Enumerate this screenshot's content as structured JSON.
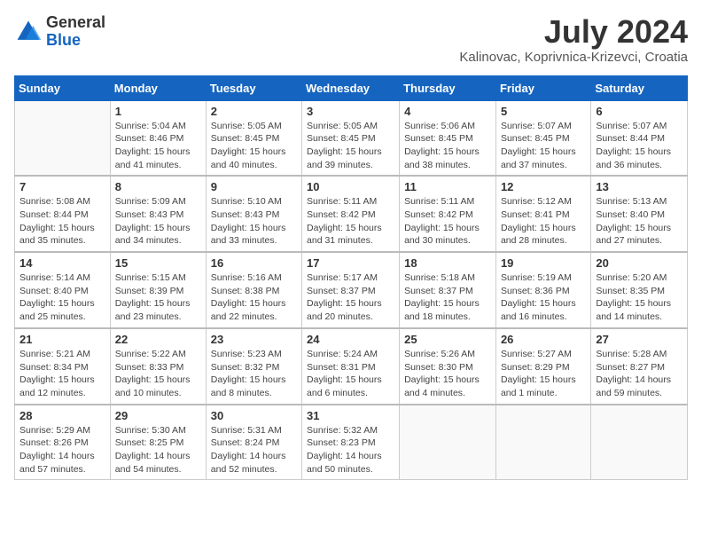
{
  "header": {
    "logo_general": "General",
    "logo_blue": "Blue",
    "month_year": "July 2024",
    "location": "Kalinovac, Koprivnica-Krizevci, Croatia"
  },
  "days_of_week": [
    "Sunday",
    "Monday",
    "Tuesday",
    "Wednesday",
    "Thursday",
    "Friday",
    "Saturday"
  ],
  "weeks": [
    [
      {
        "day": "",
        "info": ""
      },
      {
        "day": "1",
        "info": "Sunrise: 5:04 AM\nSunset: 8:46 PM\nDaylight: 15 hours\nand 41 minutes."
      },
      {
        "day": "2",
        "info": "Sunrise: 5:05 AM\nSunset: 8:45 PM\nDaylight: 15 hours\nand 40 minutes."
      },
      {
        "day": "3",
        "info": "Sunrise: 5:05 AM\nSunset: 8:45 PM\nDaylight: 15 hours\nand 39 minutes."
      },
      {
        "day": "4",
        "info": "Sunrise: 5:06 AM\nSunset: 8:45 PM\nDaylight: 15 hours\nand 38 minutes."
      },
      {
        "day": "5",
        "info": "Sunrise: 5:07 AM\nSunset: 8:45 PM\nDaylight: 15 hours\nand 37 minutes."
      },
      {
        "day": "6",
        "info": "Sunrise: 5:07 AM\nSunset: 8:44 PM\nDaylight: 15 hours\nand 36 minutes."
      }
    ],
    [
      {
        "day": "7",
        "info": "Sunrise: 5:08 AM\nSunset: 8:44 PM\nDaylight: 15 hours\nand 35 minutes."
      },
      {
        "day": "8",
        "info": "Sunrise: 5:09 AM\nSunset: 8:43 PM\nDaylight: 15 hours\nand 34 minutes."
      },
      {
        "day": "9",
        "info": "Sunrise: 5:10 AM\nSunset: 8:43 PM\nDaylight: 15 hours\nand 33 minutes."
      },
      {
        "day": "10",
        "info": "Sunrise: 5:11 AM\nSunset: 8:42 PM\nDaylight: 15 hours\nand 31 minutes."
      },
      {
        "day": "11",
        "info": "Sunrise: 5:11 AM\nSunset: 8:42 PM\nDaylight: 15 hours\nand 30 minutes."
      },
      {
        "day": "12",
        "info": "Sunrise: 5:12 AM\nSunset: 8:41 PM\nDaylight: 15 hours\nand 28 minutes."
      },
      {
        "day": "13",
        "info": "Sunrise: 5:13 AM\nSunset: 8:40 PM\nDaylight: 15 hours\nand 27 minutes."
      }
    ],
    [
      {
        "day": "14",
        "info": "Sunrise: 5:14 AM\nSunset: 8:40 PM\nDaylight: 15 hours\nand 25 minutes."
      },
      {
        "day": "15",
        "info": "Sunrise: 5:15 AM\nSunset: 8:39 PM\nDaylight: 15 hours\nand 23 minutes."
      },
      {
        "day": "16",
        "info": "Sunrise: 5:16 AM\nSunset: 8:38 PM\nDaylight: 15 hours\nand 22 minutes."
      },
      {
        "day": "17",
        "info": "Sunrise: 5:17 AM\nSunset: 8:37 PM\nDaylight: 15 hours\nand 20 minutes."
      },
      {
        "day": "18",
        "info": "Sunrise: 5:18 AM\nSunset: 8:37 PM\nDaylight: 15 hours\nand 18 minutes."
      },
      {
        "day": "19",
        "info": "Sunrise: 5:19 AM\nSunset: 8:36 PM\nDaylight: 15 hours\nand 16 minutes."
      },
      {
        "day": "20",
        "info": "Sunrise: 5:20 AM\nSunset: 8:35 PM\nDaylight: 15 hours\nand 14 minutes."
      }
    ],
    [
      {
        "day": "21",
        "info": "Sunrise: 5:21 AM\nSunset: 8:34 PM\nDaylight: 15 hours\nand 12 minutes."
      },
      {
        "day": "22",
        "info": "Sunrise: 5:22 AM\nSunset: 8:33 PM\nDaylight: 15 hours\nand 10 minutes."
      },
      {
        "day": "23",
        "info": "Sunrise: 5:23 AM\nSunset: 8:32 PM\nDaylight: 15 hours\nand 8 minutes."
      },
      {
        "day": "24",
        "info": "Sunrise: 5:24 AM\nSunset: 8:31 PM\nDaylight: 15 hours\nand 6 minutes."
      },
      {
        "day": "25",
        "info": "Sunrise: 5:26 AM\nSunset: 8:30 PM\nDaylight: 15 hours\nand 4 minutes."
      },
      {
        "day": "26",
        "info": "Sunrise: 5:27 AM\nSunset: 8:29 PM\nDaylight: 15 hours\nand 1 minute."
      },
      {
        "day": "27",
        "info": "Sunrise: 5:28 AM\nSunset: 8:27 PM\nDaylight: 14 hours\nand 59 minutes."
      }
    ],
    [
      {
        "day": "28",
        "info": "Sunrise: 5:29 AM\nSunset: 8:26 PM\nDaylight: 14 hours\nand 57 minutes."
      },
      {
        "day": "29",
        "info": "Sunrise: 5:30 AM\nSunset: 8:25 PM\nDaylight: 14 hours\nand 54 minutes."
      },
      {
        "day": "30",
        "info": "Sunrise: 5:31 AM\nSunset: 8:24 PM\nDaylight: 14 hours\nand 52 minutes."
      },
      {
        "day": "31",
        "info": "Sunrise: 5:32 AM\nSunset: 8:23 PM\nDaylight: 14 hours\nand 50 minutes."
      },
      {
        "day": "",
        "info": ""
      },
      {
        "day": "",
        "info": ""
      },
      {
        "day": "",
        "info": ""
      }
    ]
  ]
}
